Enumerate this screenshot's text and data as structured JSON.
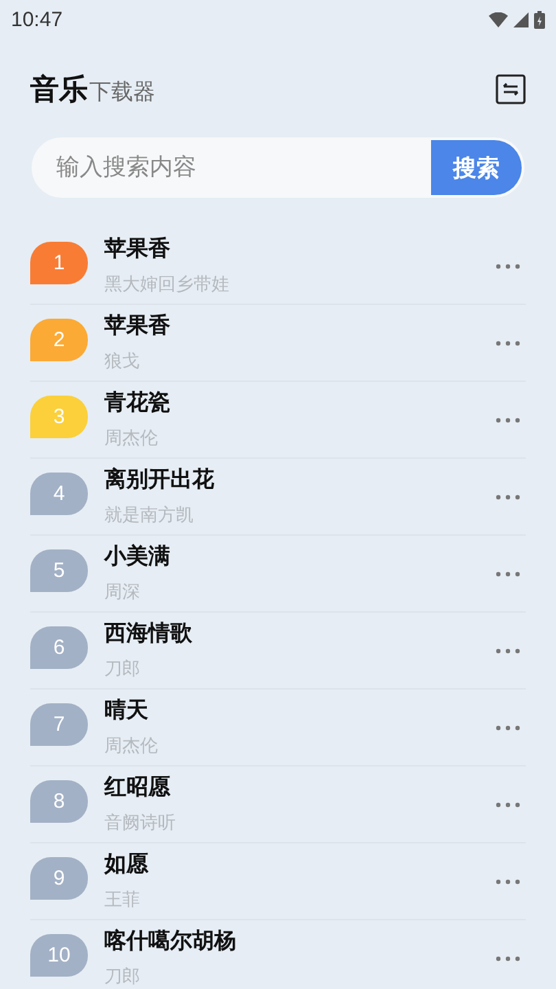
{
  "status_bar": {
    "time": "10:47"
  },
  "header": {
    "title": "音乐",
    "subtitle": "下载器"
  },
  "search": {
    "placeholder": "输入搜索内容",
    "button": "搜索"
  },
  "songs": [
    {
      "rank": "1",
      "color": "#f97c35",
      "title": "苹果香",
      "artist": "黑大婶回乡带娃"
    },
    {
      "rank": "2",
      "color": "#fbaa35",
      "title": "苹果香",
      "artist": "狼戈"
    },
    {
      "rank": "3",
      "color": "#fbd03a",
      "title": "青花瓷",
      "artist": "周杰伦"
    },
    {
      "rank": "4",
      "color": "#a3b1c6",
      "title": "离别开出花",
      "artist": "就是南方凯"
    },
    {
      "rank": "5",
      "color": "#a3b1c6",
      "title": "小美满",
      "artist": "周深"
    },
    {
      "rank": "6",
      "color": "#a3b1c6",
      "title": "西海情歌",
      "artist": "刀郎"
    },
    {
      "rank": "7",
      "color": "#a3b1c6",
      "title": "晴天",
      "artist": "周杰伦"
    },
    {
      "rank": "8",
      "color": "#a3b1c6",
      "title": "红昭愿",
      "artist": "音阙诗听"
    },
    {
      "rank": "9",
      "color": "#a3b1c6",
      "title": "如愿",
      "artist": "王菲"
    },
    {
      "rank": "10",
      "color": "#a3b1c6",
      "title": "喀什噶尔胡杨",
      "artist": "刀郎"
    }
  ]
}
